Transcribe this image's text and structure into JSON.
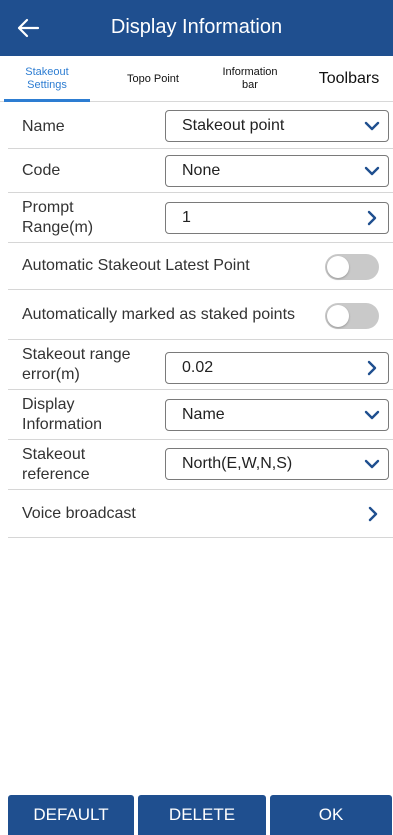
{
  "header": {
    "title": "Display Information",
    "back_icon": "back-arrow-icon"
  },
  "tabs": [
    {
      "label": "Stakeout Settings",
      "active": true
    },
    {
      "label": "Topo Point",
      "active": false
    },
    {
      "label": "Information bar",
      "active": false
    },
    {
      "label": "Toolbars",
      "active": false
    }
  ],
  "settings": {
    "name": {
      "label": "Name",
      "value": "Stakeout point"
    },
    "code": {
      "label": "Code",
      "value": "None"
    },
    "prompt_range": {
      "label": "Prompt Range(m)",
      "value": "1"
    },
    "auto_latest": {
      "label": "Automatic Stakeout Latest Point",
      "enabled": false
    },
    "auto_marked": {
      "label": "Automatically marked as staked points",
      "enabled": false
    },
    "range_error": {
      "label": "Stakeout range error(m)",
      "value": "0.02"
    },
    "display_info": {
      "label": "Display Information",
      "value": "Name"
    },
    "reference": {
      "label": "Stakeout reference",
      "value": "North(E,W,N,S)"
    },
    "voice": {
      "label": "Voice broadcast"
    }
  },
  "buttons": {
    "default": "DEFAULT",
    "delete": "DELETE",
    "ok": "OK"
  },
  "colors": {
    "primary": "#1f4f8f",
    "tab_active": "#2d7dd2",
    "toggle_off": "#c9c9c9"
  }
}
